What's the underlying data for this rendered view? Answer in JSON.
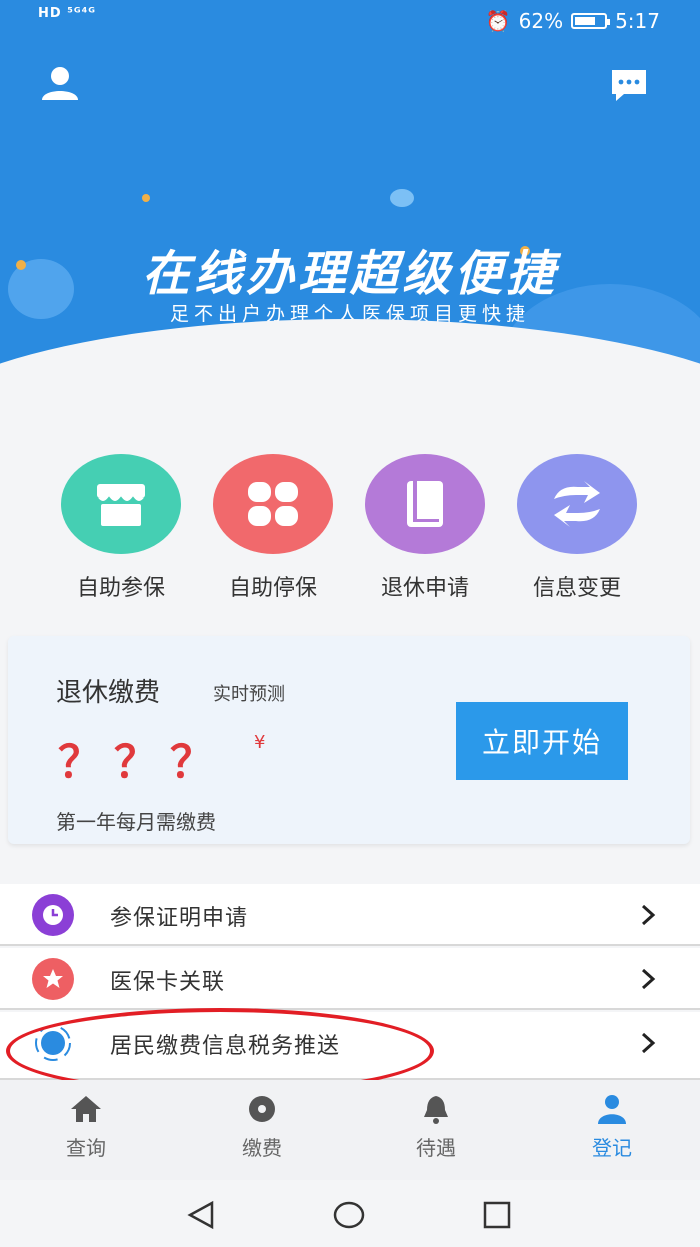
{
  "status_bar": {
    "left_text": "HD ⁵ᴳ⁴ᴳ",
    "battery": "62%",
    "time": "5:17"
  },
  "banner": {
    "title": "在线办理超级便捷",
    "subtitle": "足不出户办理个人医保项目更快捷"
  },
  "quick_actions": [
    {
      "label": "自助参保",
      "icon": "store-icon",
      "color": "#45cfb3"
    },
    {
      "label": "自助停保",
      "icon": "grid-petals-icon",
      "color": "#f1696c"
    },
    {
      "label": "退休申请",
      "icon": "book-icon",
      "color": "#b47ad8"
    },
    {
      "label": "信息变更",
      "icon": "exchange-icon",
      "color": "#8e95ee"
    }
  ],
  "card": {
    "title": "退休缴费",
    "subtitle": "实时预测",
    "value": "？？？",
    "currency": "¥",
    "note": "第一年每月需缴费",
    "button_label": "立即开始"
  },
  "list": [
    {
      "label": "参保证明申请",
      "icon": "clock-icon",
      "color": "#8b3fd6"
    },
    {
      "label": "医保卡关联",
      "icon": "star-icon",
      "color": "#ee5f63"
    },
    {
      "label": "居民缴费信息税务推送",
      "icon": "orbit-icon",
      "color": "#2a8be0"
    }
  ],
  "bottom_nav": [
    {
      "label": "查询",
      "icon": "home-icon",
      "active": false
    },
    {
      "label": "缴费",
      "icon": "disc-icon",
      "active": false
    },
    {
      "label": "待遇",
      "icon": "bell-icon",
      "active": false
    },
    {
      "label": "登记",
      "icon": "person-icon",
      "active": true
    }
  ],
  "colors": {
    "primary": "#2a8be0",
    "highlight": "#e21e25",
    "warning_value": "#e0393c"
  }
}
